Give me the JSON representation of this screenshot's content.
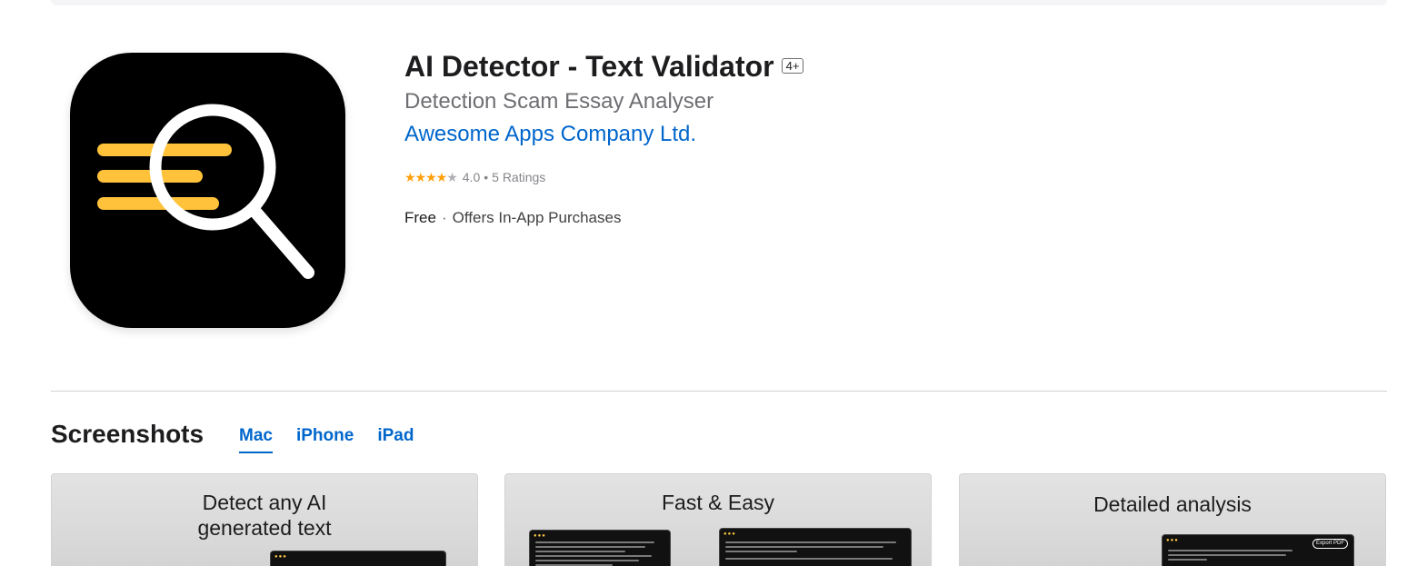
{
  "app": {
    "title": "AI Detector - Text Validator",
    "age_rating": "4+",
    "subtitle": "Detection Scam Essay Analyser",
    "developer": "Awesome Apps Company Ltd.",
    "rating": {
      "stars_display": "★★★★",
      "stars_empty": "★",
      "value": "4.0",
      "separator": "•",
      "count_label": "5 Ratings",
      "rating_fraction": 0.8
    },
    "price": "Free",
    "price_separator": "·",
    "in_app": "Offers In-App Purchases",
    "icon_name": "magnifier-text-icon",
    "colors": {
      "icon_background": "#000000",
      "icon_accent": "#ffc23a",
      "link": "#0066cc",
      "stars": "#ff9f0a"
    }
  },
  "screenshots": {
    "title": "Screenshots",
    "tabs": [
      {
        "label": "Mac",
        "active": true
      },
      {
        "label": "iPhone",
        "active": false
      },
      {
        "label": "iPad",
        "active": false
      }
    ],
    "items": [
      {
        "caption_line1": "Detect any AI",
        "caption_line2": "generated text"
      },
      {
        "caption_line1": "Fast & Easy",
        "caption_line2": ""
      },
      {
        "caption_line1": "Detailed analysis",
        "caption_line2": "",
        "button": "Export PDF"
      }
    ]
  }
}
